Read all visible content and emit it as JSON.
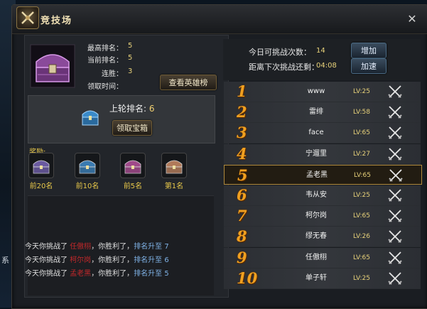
{
  "window": {
    "title": "竞技场"
  },
  "left": {
    "stats": [
      {
        "label": "最高排名：",
        "value": "5"
      },
      {
        "label": "当前排名：",
        "value": "5"
      },
      {
        "label": "连胜：",
        "value": "3"
      },
      {
        "label": "领取时间：",
        "value": ""
      }
    ],
    "hero_board_btn": "查看英雄榜",
    "last_round_label": "上轮排名:",
    "last_round_value": "6",
    "claim_btn": "领取宝箱",
    "reward_title": "奖励:",
    "rewards": [
      {
        "name": "前20名",
        "color": "#6a5aa0"
      },
      {
        "name": "前10名",
        "color": "#3a7ab0"
      },
      {
        "name": "前5名",
        "color": "#a04a8a"
      },
      {
        "name": "第1名",
        "color": "#b07a5a"
      }
    ],
    "logs": [
      {
        "pre": "今天你挑战了",
        "opp": "任傲栩",
        "mid": "，你胜利了，",
        "rank": "排名升至",
        "to": "7"
      },
      {
        "pre": "今天你挑战了",
        "opp": "柯尔岗",
        "mid": "，你胜利了，",
        "rank": "排名升至",
        "to": "6"
      },
      {
        "pre": "今天你挑战了",
        "opp": "孟老黑",
        "mid": "，你胜利了，",
        "rank": "排名升至",
        "to": "5"
      }
    ]
  },
  "right": {
    "challenges_label": "今日可挑战次数：",
    "challenges_value": "14",
    "add_btn": "增加",
    "next_label": "距离下次挑战还剩：",
    "next_value": "04:08",
    "speed_btn": "加速",
    "players": [
      {
        "rank": "1",
        "name": "www",
        "lv": "LV:25"
      },
      {
        "rank": "2",
        "name": "雷绯",
        "lv": "LV:58"
      },
      {
        "rank": "3",
        "name": "face",
        "lv": "LV:65"
      },
      {
        "rank": "4",
        "name": "宁遛里",
        "lv": "LV:27"
      },
      {
        "rank": "5",
        "name": "孟老黑",
        "lv": "LV:65"
      },
      {
        "rank": "6",
        "name": "韦从安",
        "lv": "LV:25"
      },
      {
        "rank": "7",
        "name": "柯尔岗",
        "lv": "LV:65"
      },
      {
        "rank": "8",
        "name": "缪无春",
        "lv": "LV:26"
      },
      {
        "rank": "9",
        "name": "任傲栩",
        "lv": "LV:65"
      },
      {
        "rank": "10",
        "name": "单子轩",
        "lv": "LV:25"
      }
    ],
    "selected_index": 4
  },
  "side_text": "系"
}
